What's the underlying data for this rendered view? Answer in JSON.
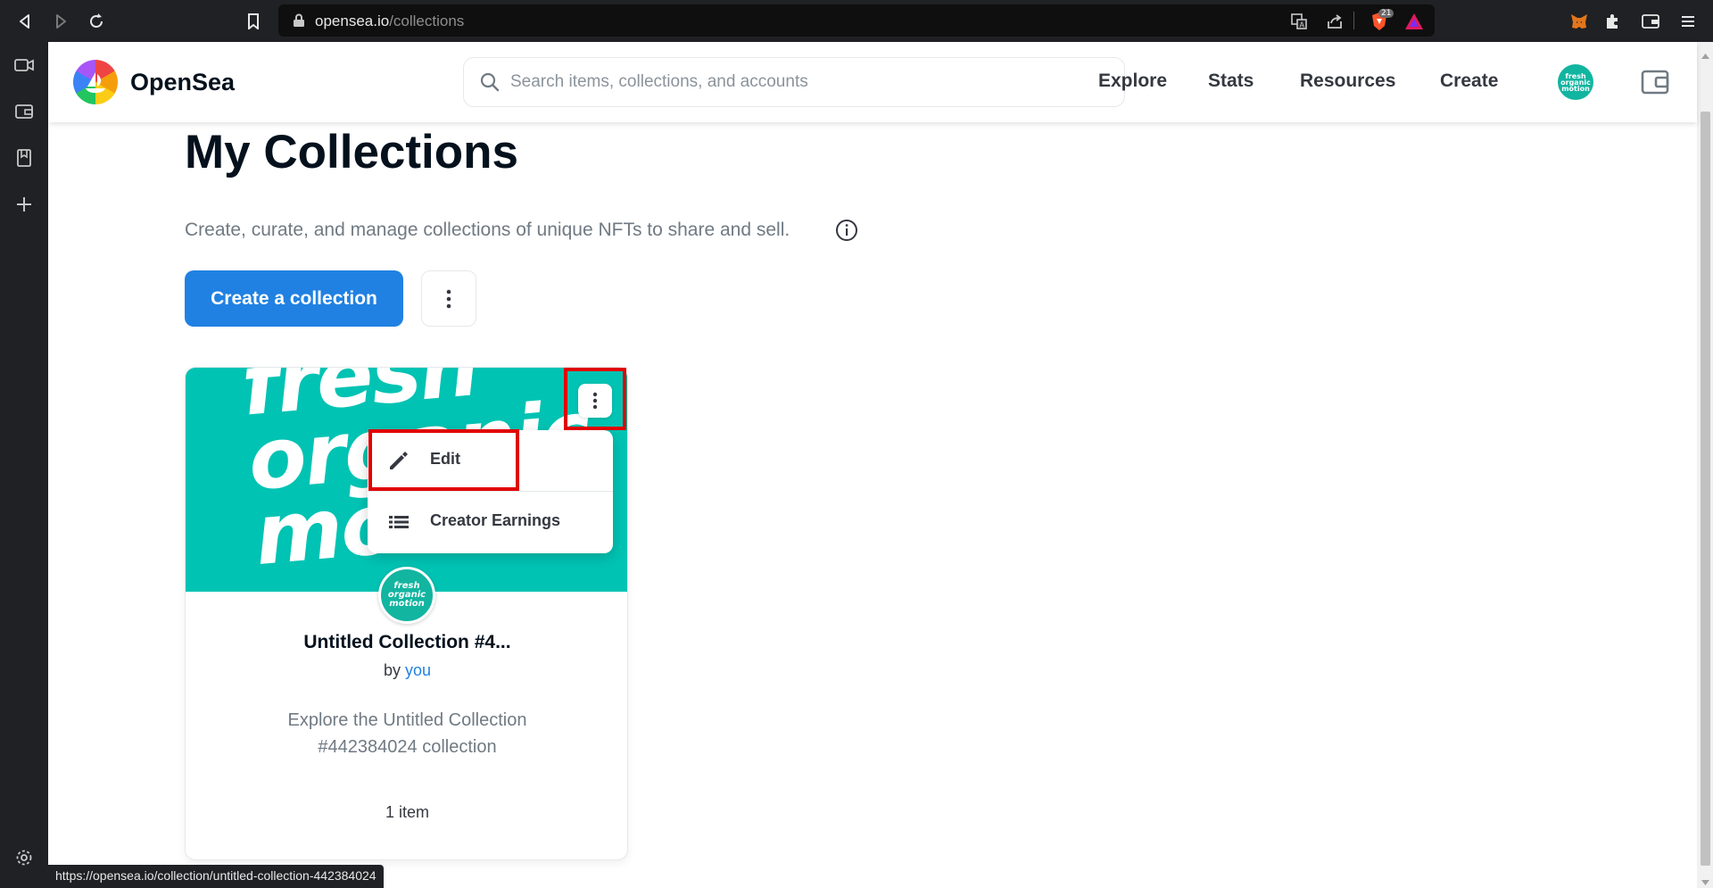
{
  "browser": {
    "url_domain": "opensea.io",
    "url_path": "/collections",
    "shield_count": "21"
  },
  "header": {
    "brand": "OpenSea",
    "search_placeholder": "Search items, collections, and accounts",
    "nav": [
      "Explore",
      "Stats",
      "Resources",
      "Create"
    ],
    "avatar_text": "fresh organic motion"
  },
  "page": {
    "title": "My Collections",
    "subtitle": "Create, curate, and manage collections of unique NFTs to share and sell.",
    "create_button": "Create a collection"
  },
  "card": {
    "banner_text": "fresh organic motion",
    "avatar_text": "fresh organic motion",
    "title": "Untitled Collection #4...",
    "by_prefix": "by",
    "by_user": "you",
    "description": "Explore the Untitled Collection #442384024 collection",
    "item_count": "1 item"
  },
  "menu": {
    "items": [
      {
        "label": "Edit",
        "icon": "pencil-icon"
      },
      {
        "label": "Creator Earnings",
        "icon": "list-icon"
      }
    ]
  },
  "status_bar": {
    "url": "https://opensea.io/collection/untitled-collection-442384024"
  },
  "colors": {
    "accent": "#2081e2",
    "banner": "#00c3b3",
    "highlight": "#e00000",
    "browser_chrome": "#202124"
  }
}
